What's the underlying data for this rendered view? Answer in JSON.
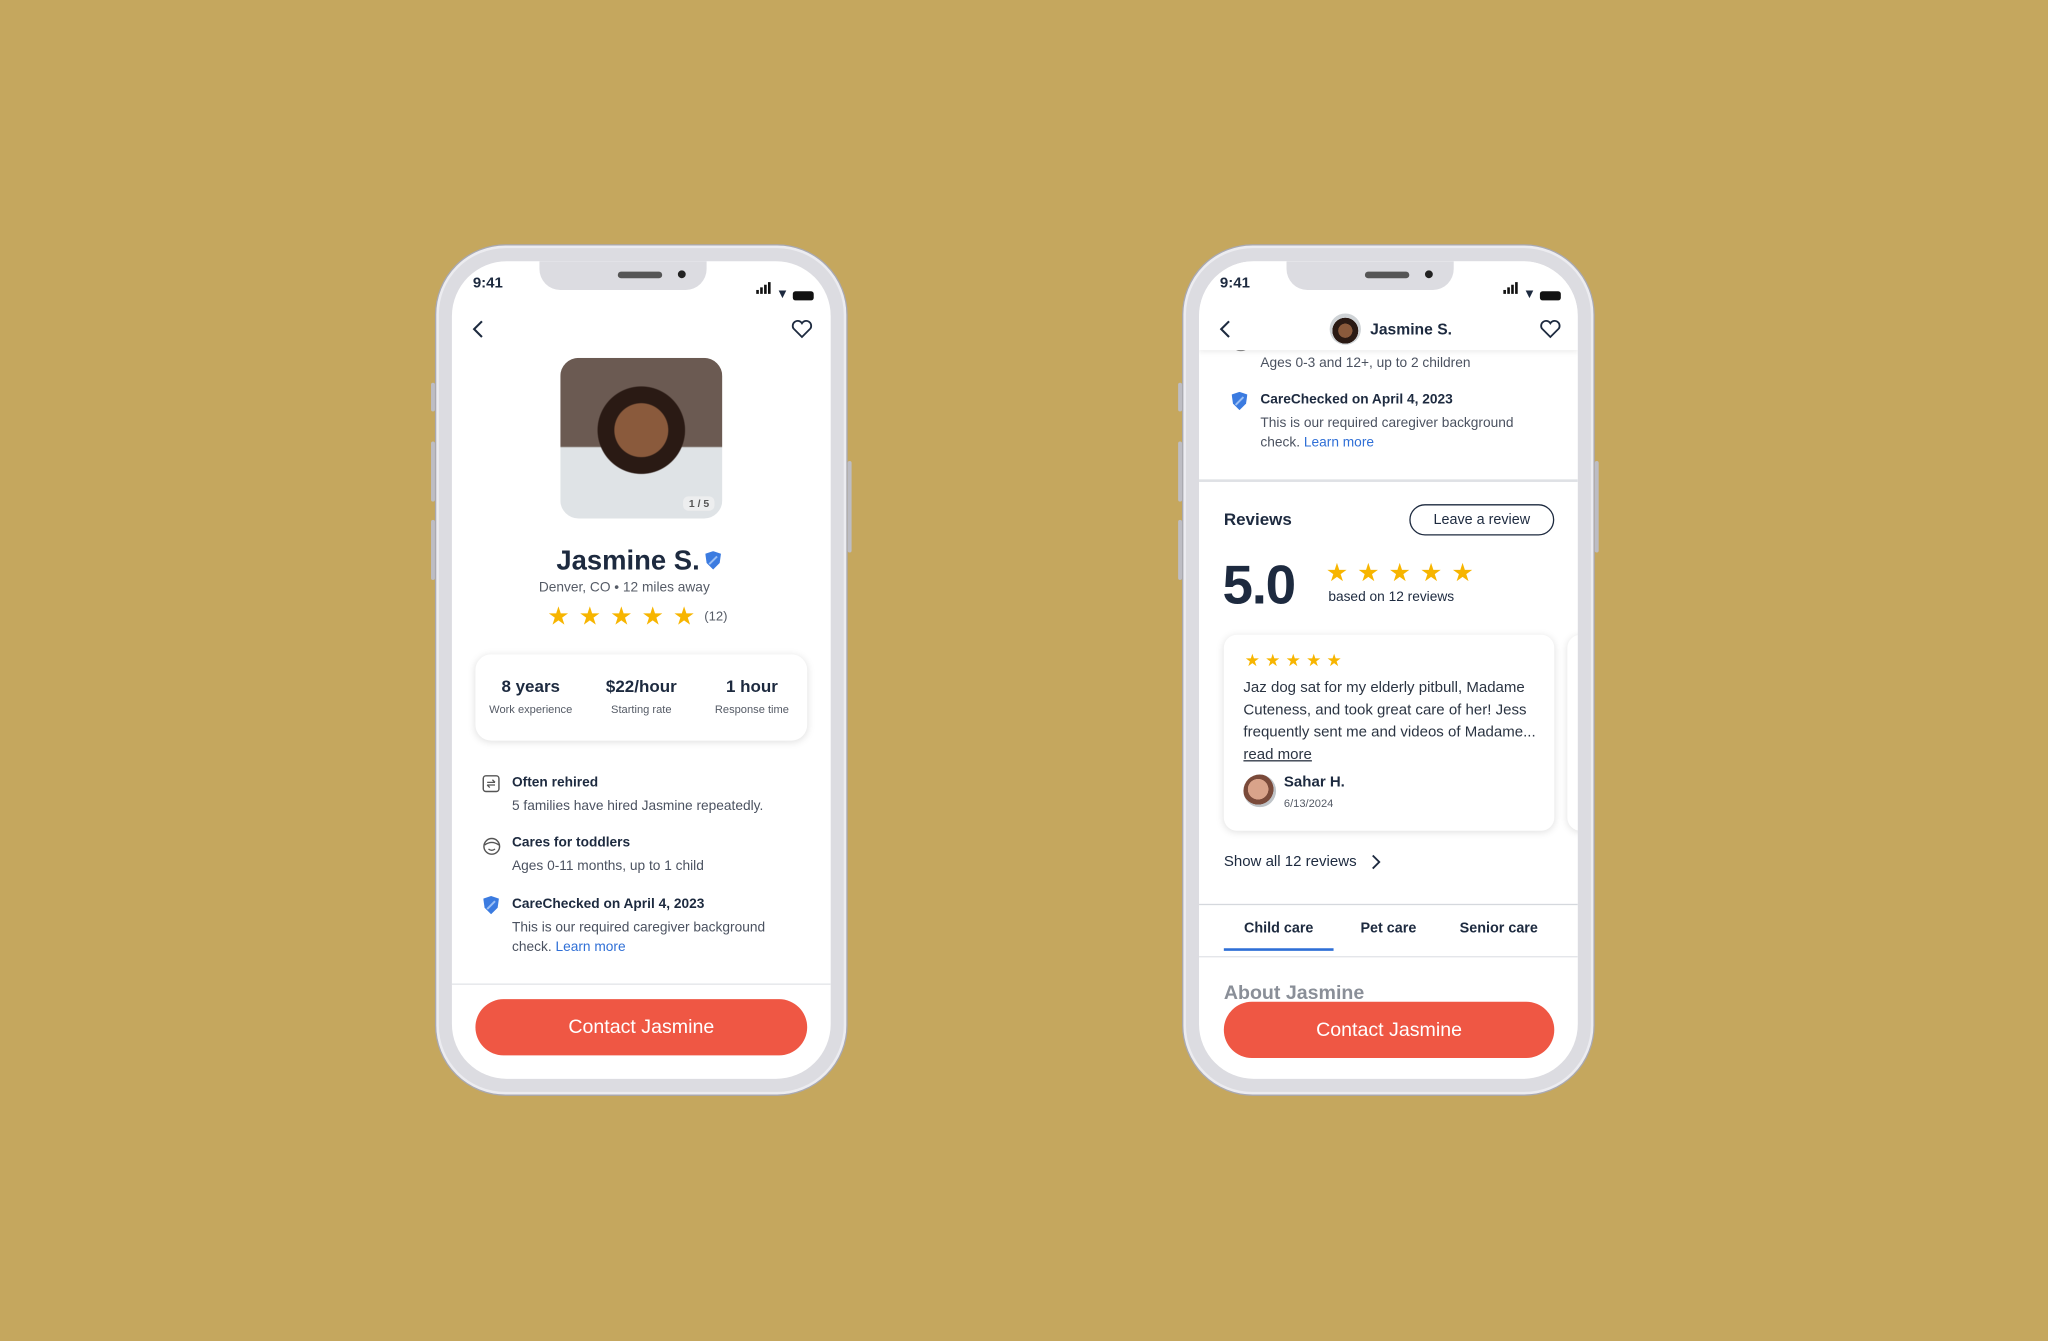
{
  "colors": {
    "background": "#c5a75e",
    "accent": "#ef5744",
    "star": "#f7b500",
    "link": "#2f6fd6",
    "text": "#1d2a3f"
  },
  "status_bar": {
    "time": "9:41"
  },
  "profile_screen": {
    "photo_counter": "1 / 5",
    "name": "Jasmine S.",
    "location": "Denver, CO • 12 miles away",
    "rating": 5,
    "review_count": "(12)",
    "stats": [
      {
        "value": "8 years",
        "label": "Work experience"
      },
      {
        "value": "$22/hour",
        "label": "Starting rate"
      },
      {
        "value": "1 hour",
        "label": "Response time"
      }
    ],
    "features": [
      {
        "icon": "repeat-icon",
        "title": "Often rehired",
        "desc": "5 families have hired Jasmine repeatedly."
      },
      {
        "icon": "toddler-icon",
        "title": "Cares for toddlers",
        "desc": "Ages 0-11 months, up to 1 child"
      },
      {
        "icon": "shield-check-icon",
        "title": "CareChecked on April 4, 2023",
        "desc": "This is our required caregiver background check.",
        "link": "Learn more"
      }
    ],
    "contact_label": "Contact Jasmine"
  },
  "reviews_screen": {
    "header_name": "Jasmine S.",
    "partial_desc": "Ages 0-3 and 12+, up to 2 children",
    "carecheck": {
      "title": "CareChecked on April 4, 2023",
      "desc": "This is our required caregiver background check.",
      "link": "Learn more"
    },
    "reviews_title": "Reviews",
    "leave_review_label": "Leave a review",
    "average": "5.0",
    "rating": 5,
    "based_on": "based on 12 reviews",
    "review": {
      "rating": 5,
      "text": "Jaz dog sat for my elderly pitbull, Madame Cuteness, and took great care of her! Jess frequently sent me and videos of Madame...",
      "read_more": "read more",
      "author": "Sahar H.",
      "date": "6/13/2024"
    },
    "show_all": "Show all 12 reviews",
    "tabs": [
      {
        "label": "Child care",
        "active": true
      },
      {
        "label": "Pet care",
        "active": false
      },
      {
        "label": "Senior care",
        "active": false
      }
    ],
    "about_title": "About Jasmine",
    "contact_label": "Contact Jasmine"
  }
}
